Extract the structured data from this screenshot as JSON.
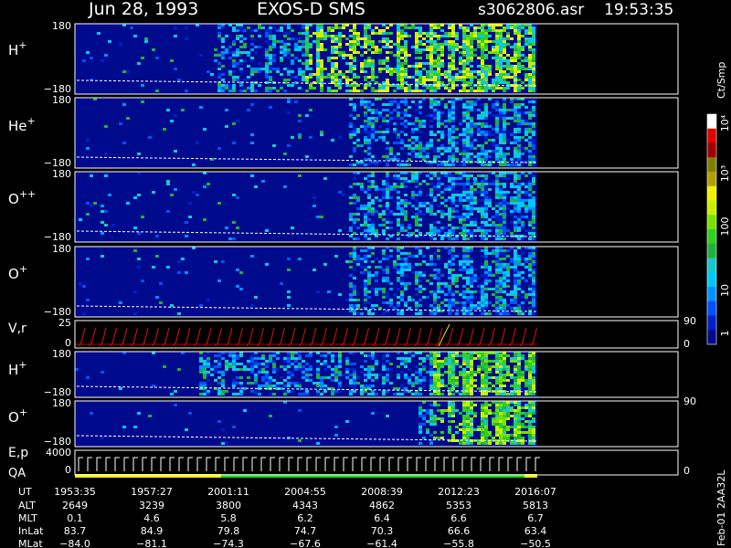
{
  "header": {
    "date": "Jun 28, 1993",
    "instrument": "EXOS-D SMS",
    "filename": "s3062806.asr",
    "time": "19:53:35"
  },
  "colorbar": {
    "unit_label": "Ct/Smp",
    "tick_labels": [
      "1",
      "10",
      "100",
      "10³",
      "10⁴"
    ],
    "colors": [
      "#000a8c",
      "#0020c8",
      "#0050ff",
      "#0090ff",
      "#00c8ff",
      "#18c8c8",
      "#20b040",
      "#30d020",
      "#78e000",
      "#c8f000",
      "#f0f000",
      "#b0a000",
      "#808000",
      "#a00000",
      "#e00000",
      "#ffffff"
    ]
  },
  "panels": [
    {
      "label": "H",
      "sup": "+",
      "ytop": "180",
      "ybot": "−180",
      "right_top": "",
      "right_bot": ""
    },
    {
      "label": "He",
      "sup": "+",
      "ytop": "180",
      "ybot": "−180",
      "right_top": "",
      "right_bot": ""
    },
    {
      "label": "O",
      "sup": "++",
      "ytop": "180",
      "ybot": "−180",
      "right_top": "",
      "right_bot": ""
    },
    {
      "label": "O",
      "sup": "+",
      "ytop": "180",
      "ybot": "−180",
      "right_top": "",
      "right_bot": ""
    },
    {
      "label": "V,r",
      "sup": "",
      "ytop": "25",
      "ybot": "0",
      "right_top": "90",
      "right_bot": "0"
    },
    {
      "label": "H",
      "sup": "+",
      "ytop": "180",
      "ybot": "−180",
      "right_top": "",
      "right_bot": ""
    },
    {
      "label": "O",
      "sup": "+",
      "ytop": "180",
      "ybot": "−180",
      "right_top": "90",
      "right_bot": ""
    },
    {
      "label": "E,p",
      "sup": "",
      "ytop": "4000",
      "ybot": "0",
      "right_top": "",
      "right_bot": "0"
    }
  ],
  "qa_label": "QA",
  "footer": {
    "row_labels": [
      "UT",
      "ALT",
      "MLT",
      "InLat",
      "MLat"
    ],
    "columns": [
      [
        "1953:35",
        "2649",
        "0.1",
        "83.7",
        "−84.0"
      ],
      [
        "1957:27",
        "3239",
        "4.6",
        "84.9",
        "−81.1"
      ],
      [
        "2001:11",
        "3800",
        "5.8",
        "79.8",
        "−74.3"
      ],
      [
        "2004:55",
        "4343",
        "6.2",
        "74.7",
        "−67.6"
      ],
      [
        "2008:39",
        "4862",
        "6.4",
        "70.3",
        "−61.4"
      ],
      [
        "2012:23",
        "5353",
        "6.6",
        "66.6",
        "−55.8"
      ],
      [
        "2016:07",
        "5813",
        "6.7",
        "63.4",
        "−50.5"
      ]
    ],
    "side_stamp": "Feb-01  2AA32L"
  },
  "chart_data": {
    "type": "heatmap",
    "title": "Jun 28, 1993   EXOS-D SMS",
    "x_tick_labels_UT": [
      "1953:35",
      "1957:27",
      "2001:11",
      "2004:55",
      "2008:39",
      "2012:23",
      "2016:07"
    ],
    "panels": [
      "H+",
      "He+",
      "O++",
      "O+",
      "V,r",
      "H+",
      "O+",
      "E,p"
    ],
    "angle_range": [
      -180,
      180
    ],
    "colorbar_range_ct_per_smp": [
      1,
      10000
    ],
    "colorbar_scale": "log",
    "vr_range": [
      0,
      25
    ],
    "ep_range": [
      0,
      4000
    ]
  }
}
